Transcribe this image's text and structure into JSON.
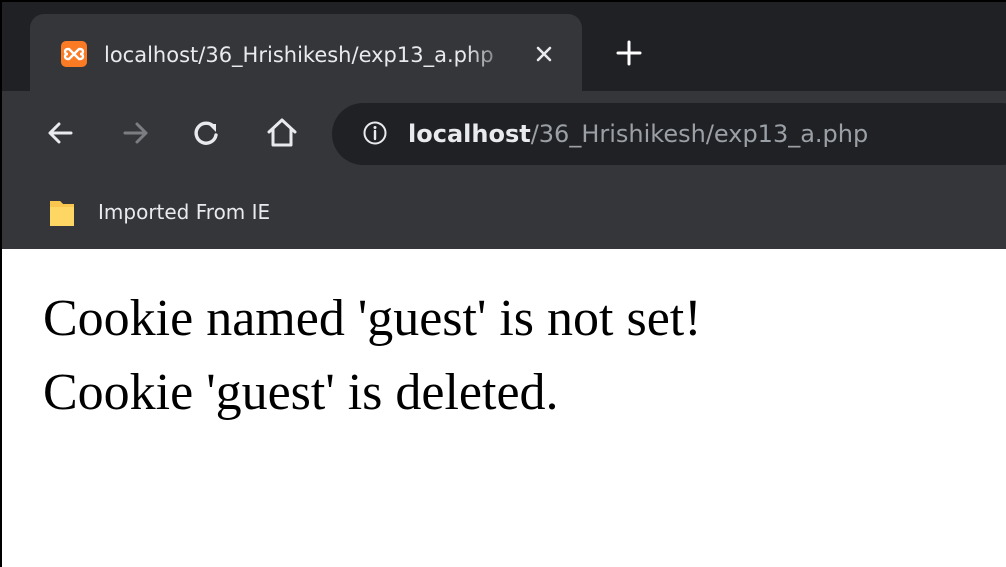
{
  "tab": {
    "title": "localhost/36_Hrishikesh/exp13_a.php",
    "favicon": "xampp-icon",
    "favicon_color": "#fb7a24"
  },
  "toolbar": {
    "back_icon": "back-arrow-icon",
    "forward_icon": "forward-arrow-icon",
    "reload_icon": "reload-icon",
    "home_icon": "home-icon"
  },
  "omnibox": {
    "info_icon": "info-icon",
    "host": "localhost",
    "path": "/36_Hrishikesh/exp13_a.php"
  },
  "bookmarks": {
    "items": [
      {
        "label": "Imported From IE",
        "icon": "folder-icon",
        "icon_color": "#fdd663"
      }
    ]
  },
  "page": {
    "lines": [
      "Cookie named 'guest' is not set!",
      "Cookie 'guest' is deleted."
    ]
  },
  "colors": {
    "tabstrip_bg": "#202124",
    "toolbar_bg": "#35363a",
    "text_light": "#e8eaed",
    "text_dim": "#9aa0a6"
  }
}
